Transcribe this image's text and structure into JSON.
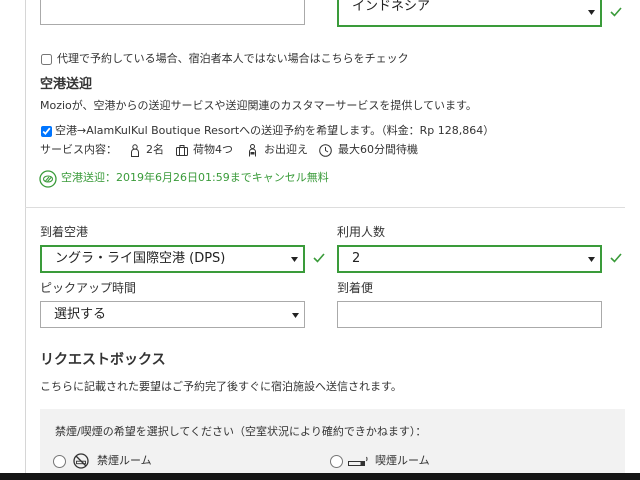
{
  "colors": {
    "accent_green": "#3a9b3a",
    "text": "#333333",
    "border_gray": "#aaaaaa",
    "box_gray": "#f2f2f2"
  },
  "top_row": {
    "left_input_value": "",
    "country_select": {
      "value": "インドネシア",
      "valid": true
    }
  },
  "booking_for_other": {
    "label": "代理で予約している場合、宿泊者本人ではない場合はこちらをチェック",
    "checked": false
  },
  "airport_transfer": {
    "heading": "空港送迎",
    "provider_text": "Mozioが、空港からの送迎サービスや送迎関連のカスタマーサービスを提供しています。",
    "opt_in": {
      "label": "空港→AlamKulKul Boutique Resortへの送迎予約を希望します。（料金：Rp 128,864）",
      "checked": true
    },
    "service_label": "サービス内容：",
    "services": [
      {
        "icon": "person-icon",
        "text": "2名"
      },
      {
        "icon": "luggage-icon",
        "text": "荷物4つ"
      },
      {
        "icon": "greeting-icon",
        "text": "お出迎え"
      },
      {
        "icon": "clock-icon",
        "text": "最大60分間待機"
      }
    ],
    "cancellation_icon": "free-cancellation-icon",
    "cancellation": "空港送迎：2019年6月26日01:59までキャンセル無料"
  },
  "transfer_form": {
    "arrival_airport": {
      "label": "到着空港",
      "value": "ングラ・ライ国際空港 (DPS)",
      "valid": true
    },
    "passengers": {
      "label": "利用人数",
      "value": "2",
      "valid": true
    },
    "pickup_time": {
      "label": "ピックアップ時間",
      "value": "選択する"
    },
    "arrival_flight": {
      "label": "到着便",
      "value": ""
    }
  },
  "request_box": {
    "heading": "リクエストボックス",
    "description": "こちらに記載された要望はご予約完了後すぐに宿泊施設へ送信されます。",
    "smoking_prompt": "禁煙/喫煙の希望を選択してください（空室状況により確約できかねます）：",
    "options": [
      {
        "label": "禁煙ルーム",
        "icon": "no-smoking-icon",
        "selected": false
      },
      {
        "label": "喫煙ルーム",
        "icon": "smoking-icon",
        "selected": false
      }
    ]
  }
}
